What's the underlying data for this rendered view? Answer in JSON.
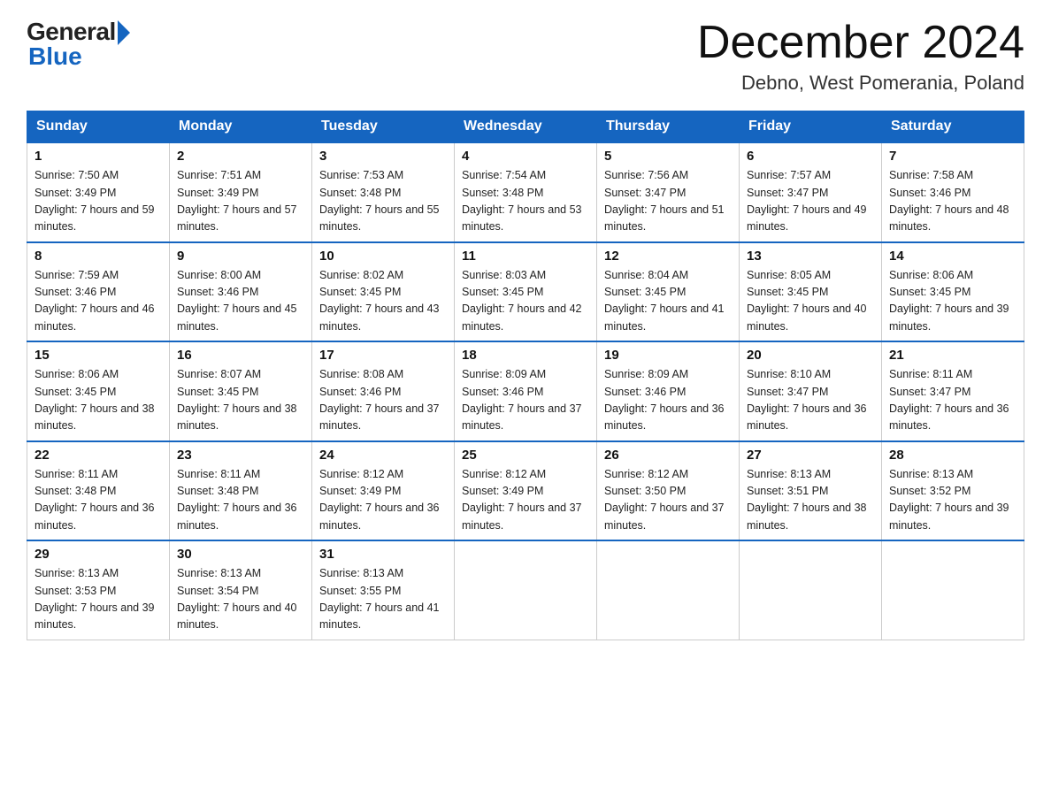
{
  "logo": {
    "general": "General",
    "blue": "Blue"
  },
  "header": {
    "month": "December 2024",
    "location": "Debno, West Pomerania, Poland"
  },
  "days_of_week": [
    "Sunday",
    "Monday",
    "Tuesday",
    "Wednesday",
    "Thursday",
    "Friday",
    "Saturday"
  ],
  "weeks": [
    [
      {
        "num": "1",
        "sunrise": "7:50 AM",
        "sunset": "3:49 PM",
        "daylight": "7 hours and 59 minutes"
      },
      {
        "num": "2",
        "sunrise": "7:51 AM",
        "sunset": "3:49 PM",
        "daylight": "7 hours and 57 minutes"
      },
      {
        "num": "3",
        "sunrise": "7:53 AM",
        "sunset": "3:48 PM",
        "daylight": "7 hours and 55 minutes"
      },
      {
        "num": "4",
        "sunrise": "7:54 AM",
        "sunset": "3:48 PM",
        "daylight": "7 hours and 53 minutes"
      },
      {
        "num": "5",
        "sunrise": "7:56 AM",
        "sunset": "3:47 PM",
        "daylight": "7 hours and 51 minutes"
      },
      {
        "num": "6",
        "sunrise": "7:57 AM",
        "sunset": "3:47 PM",
        "daylight": "7 hours and 49 minutes"
      },
      {
        "num": "7",
        "sunrise": "7:58 AM",
        "sunset": "3:46 PM",
        "daylight": "7 hours and 48 minutes"
      }
    ],
    [
      {
        "num": "8",
        "sunrise": "7:59 AM",
        "sunset": "3:46 PM",
        "daylight": "7 hours and 46 minutes"
      },
      {
        "num": "9",
        "sunrise": "8:00 AM",
        "sunset": "3:46 PM",
        "daylight": "7 hours and 45 minutes"
      },
      {
        "num": "10",
        "sunrise": "8:02 AM",
        "sunset": "3:45 PM",
        "daylight": "7 hours and 43 minutes"
      },
      {
        "num": "11",
        "sunrise": "8:03 AM",
        "sunset": "3:45 PM",
        "daylight": "7 hours and 42 minutes"
      },
      {
        "num": "12",
        "sunrise": "8:04 AM",
        "sunset": "3:45 PM",
        "daylight": "7 hours and 41 minutes"
      },
      {
        "num": "13",
        "sunrise": "8:05 AM",
        "sunset": "3:45 PM",
        "daylight": "7 hours and 40 minutes"
      },
      {
        "num": "14",
        "sunrise": "8:06 AM",
        "sunset": "3:45 PM",
        "daylight": "7 hours and 39 minutes"
      }
    ],
    [
      {
        "num": "15",
        "sunrise": "8:06 AM",
        "sunset": "3:45 PM",
        "daylight": "7 hours and 38 minutes"
      },
      {
        "num": "16",
        "sunrise": "8:07 AM",
        "sunset": "3:45 PM",
        "daylight": "7 hours and 38 minutes"
      },
      {
        "num": "17",
        "sunrise": "8:08 AM",
        "sunset": "3:46 PM",
        "daylight": "7 hours and 37 minutes"
      },
      {
        "num": "18",
        "sunrise": "8:09 AM",
        "sunset": "3:46 PM",
        "daylight": "7 hours and 37 minutes"
      },
      {
        "num": "19",
        "sunrise": "8:09 AM",
        "sunset": "3:46 PM",
        "daylight": "7 hours and 36 minutes"
      },
      {
        "num": "20",
        "sunrise": "8:10 AM",
        "sunset": "3:47 PM",
        "daylight": "7 hours and 36 minutes"
      },
      {
        "num": "21",
        "sunrise": "8:11 AM",
        "sunset": "3:47 PM",
        "daylight": "7 hours and 36 minutes"
      }
    ],
    [
      {
        "num": "22",
        "sunrise": "8:11 AM",
        "sunset": "3:48 PM",
        "daylight": "7 hours and 36 minutes"
      },
      {
        "num": "23",
        "sunrise": "8:11 AM",
        "sunset": "3:48 PM",
        "daylight": "7 hours and 36 minutes"
      },
      {
        "num": "24",
        "sunrise": "8:12 AM",
        "sunset": "3:49 PM",
        "daylight": "7 hours and 36 minutes"
      },
      {
        "num": "25",
        "sunrise": "8:12 AM",
        "sunset": "3:49 PM",
        "daylight": "7 hours and 37 minutes"
      },
      {
        "num": "26",
        "sunrise": "8:12 AM",
        "sunset": "3:50 PM",
        "daylight": "7 hours and 37 minutes"
      },
      {
        "num": "27",
        "sunrise": "8:13 AM",
        "sunset": "3:51 PM",
        "daylight": "7 hours and 38 minutes"
      },
      {
        "num": "28",
        "sunrise": "8:13 AM",
        "sunset": "3:52 PM",
        "daylight": "7 hours and 39 minutes"
      }
    ],
    [
      {
        "num": "29",
        "sunrise": "8:13 AM",
        "sunset": "3:53 PM",
        "daylight": "7 hours and 39 minutes"
      },
      {
        "num": "30",
        "sunrise": "8:13 AM",
        "sunset": "3:54 PM",
        "daylight": "7 hours and 40 minutes"
      },
      {
        "num": "31",
        "sunrise": "8:13 AM",
        "sunset": "3:55 PM",
        "daylight": "7 hours and 41 minutes"
      },
      null,
      null,
      null,
      null
    ]
  ]
}
